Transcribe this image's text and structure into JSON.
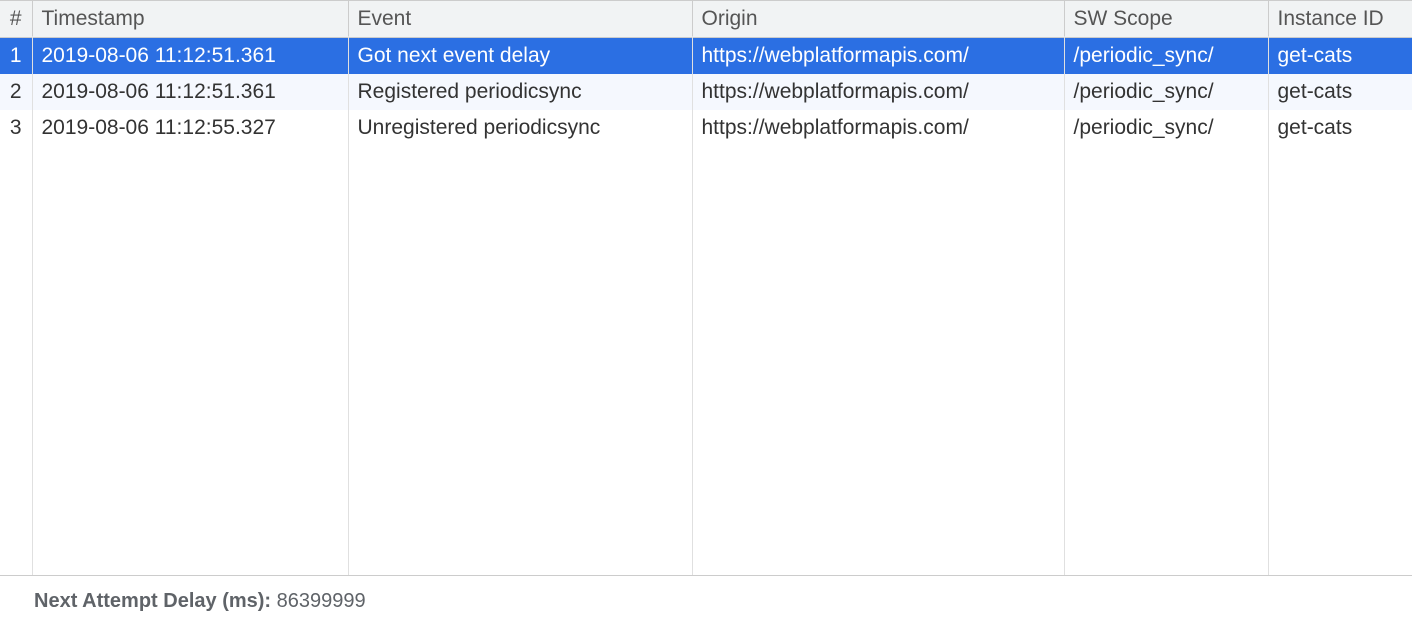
{
  "table": {
    "headers": {
      "num": "#",
      "timestamp": "Timestamp",
      "event": "Event",
      "origin": "Origin",
      "sw_scope": "SW Scope",
      "instance_id": "Instance ID"
    },
    "rows": [
      {
        "num": "1",
        "timestamp": "2019-08-06 11:12:51.361",
        "event": "Got next event delay",
        "origin": "https://webplatformapis.com/",
        "sw_scope": "/periodic_sync/",
        "instance_id": "get-cats",
        "selected": true
      },
      {
        "num": "2",
        "timestamp": "2019-08-06 11:12:51.361",
        "event": "Registered periodicsync",
        "origin": "https://webplatformapis.com/",
        "sw_scope": "/periodic_sync/",
        "instance_id": "get-cats",
        "striped": true
      },
      {
        "num": "3",
        "timestamp": "2019-08-06 11:12:55.327",
        "event": "Unregistered periodicsync",
        "origin": "https://webplatformapis.com/",
        "sw_scope": "/periodic_sync/",
        "instance_id": "get-cats"
      }
    ]
  },
  "footer": {
    "label": "Next Attempt Delay (ms): ",
    "value": "86399999"
  }
}
